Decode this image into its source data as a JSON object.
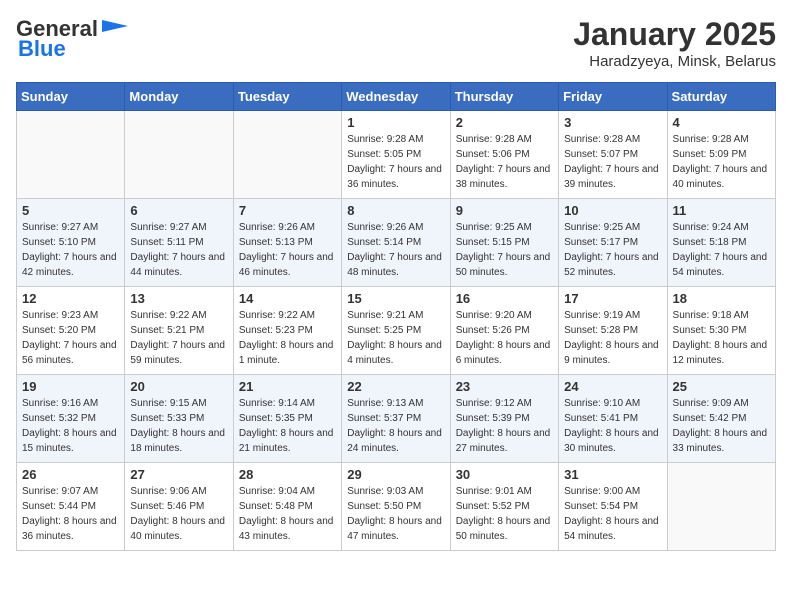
{
  "header": {
    "logo_general": "General",
    "logo_blue": "Blue",
    "month": "January 2025",
    "location": "Haradzyeya, Minsk, Belarus"
  },
  "days_of_week": [
    "Sunday",
    "Monday",
    "Tuesday",
    "Wednesday",
    "Thursday",
    "Friday",
    "Saturday"
  ],
  "weeks": [
    [
      {
        "day": "",
        "info": ""
      },
      {
        "day": "",
        "info": ""
      },
      {
        "day": "",
        "info": ""
      },
      {
        "day": "1",
        "info": "Sunrise: 9:28 AM\nSunset: 5:05 PM\nDaylight: 7 hours and 36 minutes."
      },
      {
        "day": "2",
        "info": "Sunrise: 9:28 AM\nSunset: 5:06 PM\nDaylight: 7 hours and 38 minutes."
      },
      {
        "day": "3",
        "info": "Sunrise: 9:28 AM\nSunset: 5:07 PM\nDaylight: 7 hours and 39 minutes."
      },
      {
        "day": "4",
        "info": "Sunrise: 9:28 AM\nSunset: 5:09 PM\nDaylight: 7 hours and 40 minutes."
      }
    ],
    [
      {
        "day": "5",
        "info": "Sunrise: 9:27 AM\nSunset: 5:10 PM\nDaylight: 7 hours and 42 minutes."
      },
      {
        "day": "6",
        "info": "Sunrise: 9:27 AM\nSunset: 5:11 PM\nDaylight: 7 hours and 44 minutes."
      },
      {
        "day": "7",
        "info": "Sunrise: 9:26 AM\nSunset: 5:13 PM\nDaylight: 7 hours and 46 minutes."
      },
      {
        "day": "8",
        "info": "Sunrise: 9:26 AM\nSunset: 5:14 PM\nDaylight: 7 hours and 48 minutes."
      },
      {
        "day": "9",
        "info": "Sunrise: 9:25 AM\nSunset: 5:15 PM\nDaylight: 7 hours and 50 minutes."
      },
      {
        "day": "10",
        "info": "Sunrise: 9:25 AM\nSunset: 5:17 PM\nDaylight: 7 hours and 52 minutes."
      },
      {
        "day": "11",
        "info": "Sunrise: 9:24 AM\nSunset: 5:18 PM\nDaylight: 7 hours and 54 minutes."
      }
    ],
    [
      {
        "day": "12",
        "info": "Sunrise: 9:23 AM\nSunset: 5:20 PM\nDaylight: 7 hours and 56 minutes."
      },
      {
        "day": "13",
        "info": "Sunrise: 9:22 AM\nSunset: 5:21 PM\nDaylight: 7 hours and 59 minutes."
      },
      {
        "day": "14",
        "info": "Sunrise: 9:22 AM\nSunset: 5:23 PM\nDaylight: 8 hours and 1 minute."
      },
      {
        "day": "15",
        "info": "Sunrise: 9:21 AM\nSunset: 5:25 PM\nDaylight: 8 hours and 4 minutes."
      },
      {
        "day": "16",
        "info": "Sunrise: 9:20 AM\nSunset: 5:26 PM\nDaylight: 8 hours and 6 minutes."
      },
      {
        "day": "17",
        "info": "Sunrise: 9:19 AM\nSunset: 5:28 PM\nDaylight: 8 hours and 9 minutes."
      },
      {
        "day": "18",
        "info": "Sunrise: 9:18 AM\nSunset: 5:30 PM\nDaylight: 8 hours and 12 minutes."
      }
    ],
    [
      {
        "day": "19",
        "info": "Sunrise: 9:16 AM\nSunset: 5:32 PM\nDaylight: 8 hours and 15 minutes."
      },
      {
        "day": "20",
        "info": "Sunrise: 9:15 AM\nSunset: 5:33 PM\nDaylight: 8 hours and 18 minutes."
      },
      {
        "day": "21",
        "info": "Sunrise: 9:14 AM\nSunset: 5:35 PM\nDaylight: 8 hours and 21 minutes."
      },
      {
        "day": "22",
        "info": "Sunrise: 9:13 AM\nSunset: 5:37 PM\nDaylight: 8 hours and 24 minutes."
      },
      {
        "day": "23",
        "info": "Sunrise: 9:12 AM\nSunset: 5:39 PM\nDaylight: 8 hours and 27 minutes."
      },
      {
        "day": "24",
        "info": "Sunrise: 9:10 AM\nSunset: 5:41 PM\nDaylight: 8 hours and 30 minutes."
      },
      {
        "day": "25",
        "info": "Sunrise: 9:09 AM\nSunset: 5:42 PM\nDaylight: 8 hours and 33 minutes."
      }
    ],
    [
      {
        "day": "26",
        "info": "Sunrise: 9:07 AM\nSunset: 5:44 PM\nDaylight: 8 hours and 36 minutes."
      },
      {
        "day": "27",
        "info": "Sunrise: 9:06 AM\nSunset: 5:46 PM\nDaylight: 8 hours and 40 minutes."
      },
      {
        "day": "28",
        "info": "Sunrise: 9:04 AM\nSunset: 5:48 PM\nDaylight: 8 hours and 43 minutes."
      },
      {
        "day": "29",
        "info": "Sunrise: 9:03 AM\nSunset: 5:50 PM\nDaylight: 8 hours and 47 minutes."
      },
      {
        "day": "30",
        "info": "Sunrise: 9:01 AM\nSunset: 5:52 PM\nDaylight: 8 hours and 50 minutes."
      },
      {
        "day": "31",
        "info": "Sunrise: 9:00 AM\nSunset: 5:54 PM\nDaylight: 8 hours and 54 minutes."
      },
      {
        "day": "",
        "info": ""
      }
    ]
  ]
}
